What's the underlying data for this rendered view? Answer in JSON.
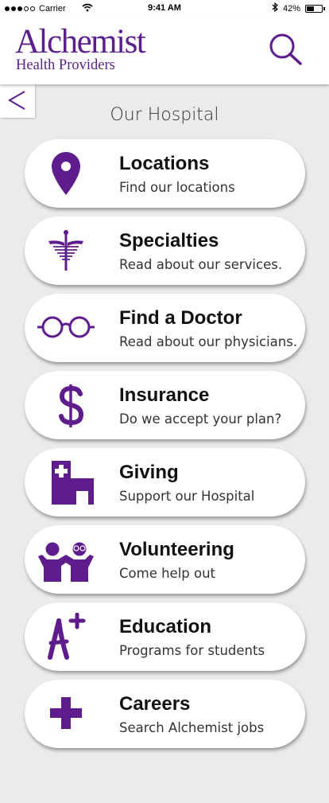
{
  "status_bar": {
    "carrier": "Carrier",
    "time": "9:41 AM",
    "battery": "42%",
    "battery_level": 0.42,
    "signal_bars_filled": 3,
    "signal_bars_total": 5
  },
  "header": {
    "logo_title": "Alchemist",
    "logo_subtitle": "Health Providers",
    "search_icon": "search-icon"
  },
  "nav": {
    "back_label": "<"
  },
  "page": {
    "title": "Our Hospital"
  },
  "colors": {
    "brand_purple": "#5b1f8c",
    "icon_purple": "#5e1c8c",
    "background": "#ebebeb",
    "card": "#ffffff"
  },
  "menu": [
    {
      "icon": "location-pin-icon",
      "title": "Locations",
      "subtitle": "Find our locations"
    },
    {
      "icon": "caduceus-icon",
      "title": "Specialties",
      "subtitle": "Read about our services."
    },
    {
      "icon": "glasses-icon",
      "title": "Find a Doctor",
      "subtitle": "Read about our physicians."
    },
    {
      "icon": "dollar-icon",
      "title": "Insurance",
      "subtitle": "Do we accept your plan?"
    },
    {
      "icon": "hospital-building-icon",
      "title": "Giving",
      "subtitle": "Support our Hospital"
    },
    {
      "icon": "volunteers-icon",
      "title": "Volunteering",
      "subtitle": "Come help out"
    },
    {
      "icon": "a-plus-icon",
      "title": "Education",
      "subtitle": "Programs for students"
    },
    {
      "icon": "medical-cross-icon",
      "title": "Careers",
      "subtitle": "Search Alchemist jobs"
    }
  ]
}
